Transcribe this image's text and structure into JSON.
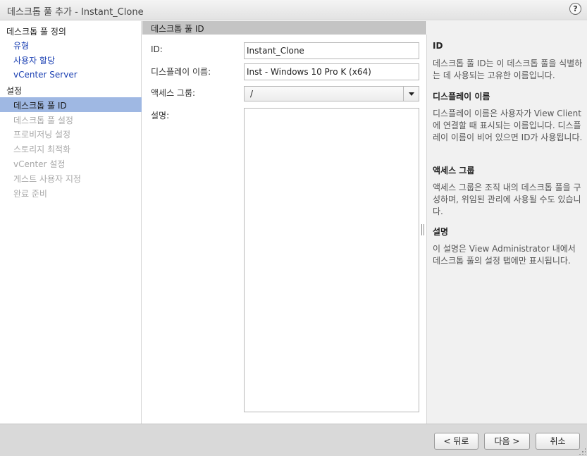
{
  "window": {
    "title": "데스크톱 풀 추가 - Instant_Clone",
    "help_label": "?"
  },
  "sidebar": {
    "group1_heading": "데스크톱 풀 정의",
    "group1_items": [
      "유형",
      "사용자 할당",
      "vCenter Server"
    ],
    "group2_heading": "설정",
    "active_item": "데스크톱 풀 ID",
    "disabled_items": [
      "데스크톱 풀 설정",
      "프로비저닝 설정",
      "스토리지 최적화",
      "vCenter 설정",
      "게스트 사용자 지정",
      "완료 준비"
    ]
  },
  "section": {
    "title": "데스크톱 풀 ID"
  },
  "form": {
    "id_label": "ID:",
    "id_value": "Instant_Clone",
    "display_name_label": "디스플레이 이름:",
    "display_name_value": "Inst - Windows 10 Pro K (x64)",
    "access_group_label": "액세스 그룹:",
    "access_group_value": "/",
    "description_label": "설명:",
    "description_value": ""
  },
  "help": {
    "sections": [
      {
        "heading": "ID",
        "text": "데스크톱 풀 ID는 이 데스크톱 풀을 식별하는 데 사용되는 고유한 이름입니다."
      },
      {
        "heading": "디스플레이 이름",
        "text": "디스플레이 이름은 사용자가 View Client에 연결할 때 표시되는 이름입니다. 디스플레이 이름이 비어 있으면 ID가 사용됩니다."
      },
      {
        "heading": "액세스 그룹",
        "text": "액세스 그룹은 조직 내의 데스크톱 풀을 구성하며, 위임된 관리에 사용될 수도 있습니다."
      },
      {
        "heading": "설명",
        "text": "이 설명은 View Administrator 내에서 데스크톱 풀의 설정 탭에만 표시됩니다."
      }
    ]
  },
  "footer": {
    "back_label": "< 뒤로",
    "next_label": "다음 >",
    "cancel_label": "취소"
  }
}
